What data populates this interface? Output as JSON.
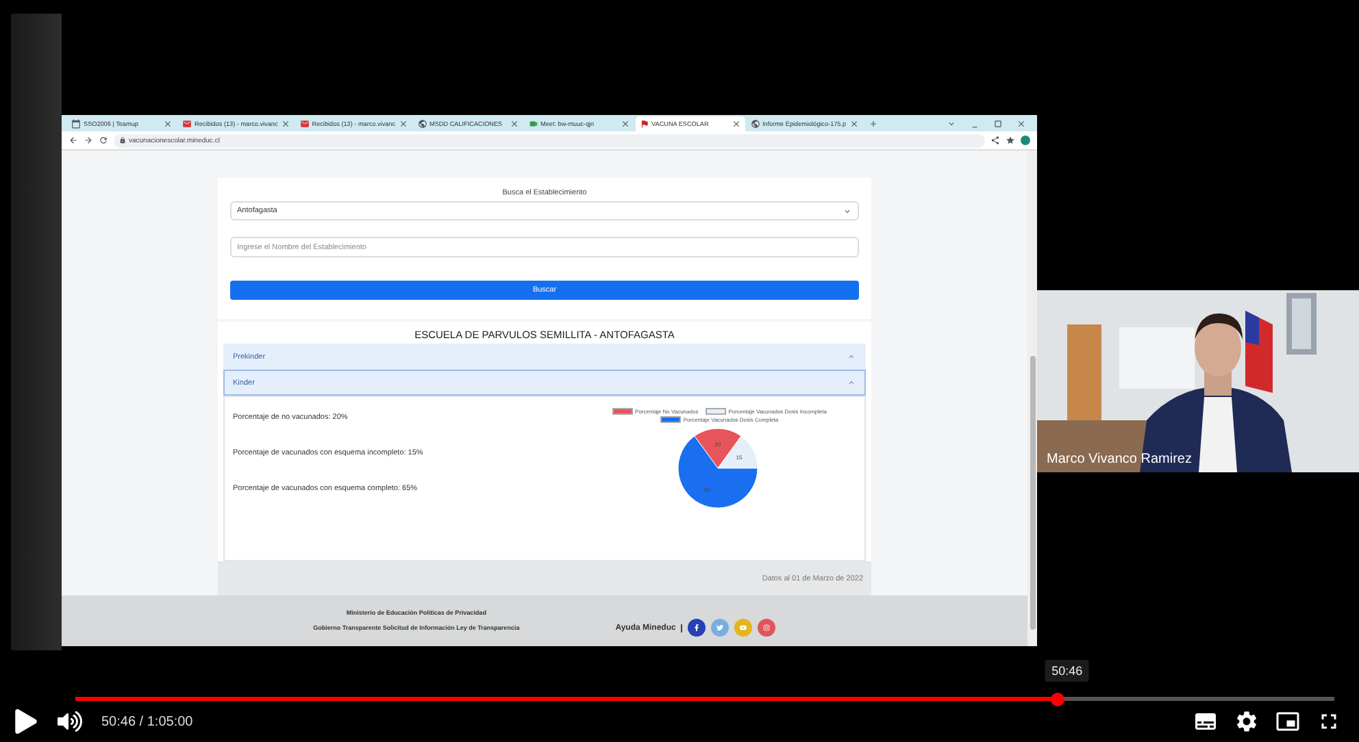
{
  "browser": {
    "tabs": [
      {
        "title": "SSO2006 | Teamup",
        "kind": "calendar",
        "selected": false
      },
      {
        "title": "Recibidos (13) - marco.vivanc",
        "kind": "mail",
        "selected": false
      },
      {
        "title": "Recibidos (13) - marco.vivanc",
        "kind": "mail",
        "selected": false
      },
      {
        "title": "MSDD CALIFICACIONES",
        "kind": "globe",
        "selected": false
      },
      {
        "title": "Meet: bw-muuc-qjn",
        "kind": "meet",
        "selected": false
      },
      {
        "title": "VACUNA ESCOLAR",
        "kind": "flag",
        "selected": true
      },
      {
        "title": "Informe Epidemiológico-175.p",
        "kind": "globe",
        "selected": false
      }
    ],
    "url": "vacunacionescolar.mineduc.cl"
  },
  "search": {
    "heading": "Busca el Establecimiento",
    "region": "Antofagasta",
    "placeholder": "Ingrese el Nombre del Establecimiento",
    "button": "Buscar"
  },
  "school": {
    "title": "ESCUELA DE PARVULOS SEMILLITA - ANTOFAGASTA",
    "sections": [
      {
        "label": "Prekinder",
        "selected": false
      },
      {
        "label": "Kinder",
        "selected": true
      }
    ],
    "stats": [
      "Porcentaje de no vacunados: 20%",
      "Porcentaje de vacunados con esquema incompleto: 15%",
      "Porcentaje de vacunados con esquema completo: 65%"
    ],
    "chart_data": {
      "type": "pie",
      "categories": [
        "Porcentaje No Vacunados",
        "Porcentaje Vacunados Dosis Incompleta",
        "Porcentaje Vacunados Dosis Completa"
      ],
      "values": [
        20,
        15,
        65
      ],
      "colors": [
        "#e8545c",
        "#e6eef8",
        "#1a6ff0"
      ],
      "data_labels": true
    }
  },
  "date_note": "Datos al 01 de Marzo de 2022",
  "footer": {
    "lines": [
      "Ministerio de Educación Políticas de Privacidad",
      "Gobierno Transparente Solicitud de Información Ley de Transparencia"
    ],
    "help": "Ayuda Mineduc",
    "social": [
      {
        "kind": "facebook",
        "color": "#2840b8"
      },
      {
        "kind": "twitter",
        "color": "#7aaee0"
      },
      {
        "kind": "youtube",
        "color": "#e5b51a"
      },
      {
        "kind": "instagram",
        "color": "#e0555c"
      }
    ]
  },
  "webcam": {
    "name": "Marco Vivanco Ramirez"
  },
  "player": {
    "time": "50:46 / 1:05:00",
    "tooltip": "50:46",
    "level": 0.78
  }
}
